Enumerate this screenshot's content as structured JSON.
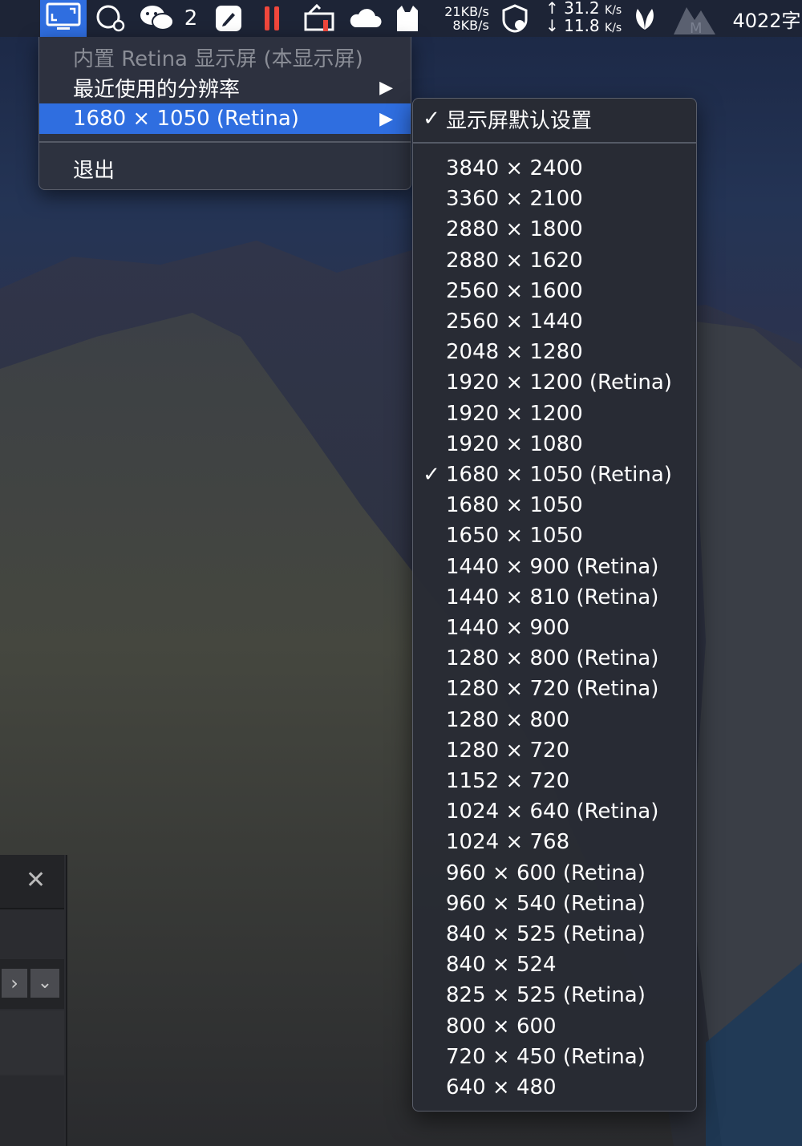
{
  "menubar": {
    "wechat_badge": "2",
    "net_speed_up": "21KB/s",
    "net_speed_down": "8KB/s",
    "net_up_value": "31.2",
    "net_up_unit": "K/s",
    "net_down_value": "11.8",
    "net_down_unit": "K/s",
    "word_count": "4022字",
    "accent_color": "#2f6ee0"
  },
  "menu": {
    "header": "内置 Retina 显示屏 (本显示屏)",
    "recent_label": "最近使用的分辨率",
    "current_label": "1680 × 1050 (Retina)",
    "quit_label": "退出",
    "arrow": "▶"
  },
  "submenu": {
    "default_label": "显示屏默认设置",
    "check": "✓",
    "items": [
      "3840 × 2400",
      "3360 × 2100",
      "2880 × 1800",
      "2880 × 1620",
      "2560 × 1600",
      "2560 × 1440",
      "2048 × 1280",
      "1920 × 1200 (Retina)",
      "1920 × 1200",
      "1920 × 1080",
      "1680 × 1050 (Retina)",
      "1680 × 1050",
      "1650 × 1050",
      "1440 × 900 (Retina)",
      "1440 × 810 (Retina)",
      "1440 × 900",
      "1280 × 800 (Retina)",
      "1280 × 720 (Retina)",
      "1280 × 800",
      "1280 × 720",
      "1152 × 720",
      "1024 × 640 (Retina)",
      "1024 × 768",
      "960 × 600 (Retina)",
      "960 × 540 (Retina)",
      "840 × 525 (Retina)",
      "840 × 524",
      "825 × 525 (Retina)",
      "800 × 600",
      "720 × 450 (Retina)",
      "640 × 480"
    ],
    "checked_index": 10
  }
}
